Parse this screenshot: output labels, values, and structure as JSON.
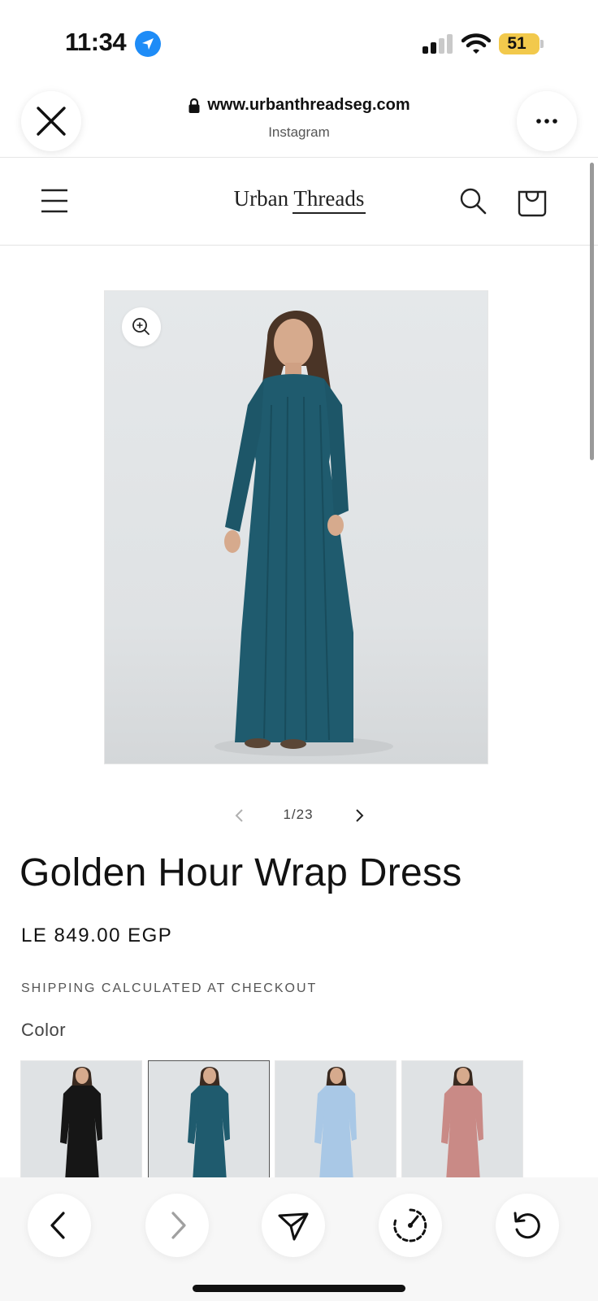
{
  "status_bar": {
    "time": "11:34",
    "battery_level": "51",
    "battery_color": "#f2c94c"
  },
  "browser": {
    "url": "www.urbanthreadseg.com",
    "source": "Instagram",
    "close_icon": "close-icon",
    "more_icon": "more-icon",
    "lock_icon": "lock-icon"
  },
  "store": {
    "logo_text": "Urban Threads",
    "menu_icon": "hamburger-menu-icon",
    "search_icon": "search-icon",
    "cart_icon": "cart-icon"
  },
  "product": {
    "image_label": "Golden Hour Wrap Dress",
    "dress_color": "#1f5b6e",
    "pagination": "1/23",
    "title": "Golden Hour Wrap Dress",
    "price": "LE 849.00 EGP",
    "shipping_note": "SHIPPING CALCULATED AT CHECKOUT",
    "color_label": "Color",
    "color_swatches": [
      {
        "color": "#161616",
        "selected": false
      },
      {
        "color": "#1f5b6e",
        "selected": true
      },
      {
        "color": "#a9c8e6",
        "selected": false
      },
      {
        "color": "#c98a86",
        "selected": false
      }
    ]
  },
  "toolbar": {
    "buttons": [
      "back-icon",
      "forward-icon",
      "share-icon",
      "speedometer-icon",
      "reload-icon"
    ]
  }
}
